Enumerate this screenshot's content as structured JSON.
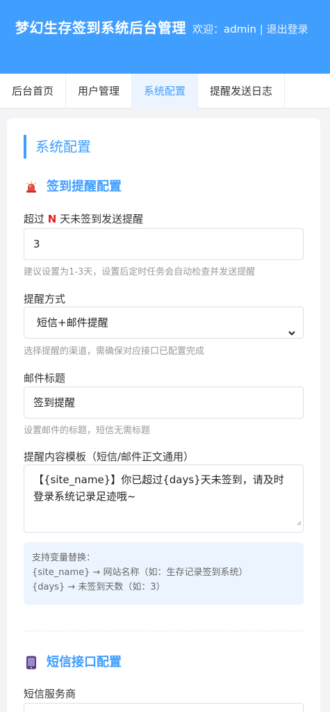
{
  "header": {
    "title": "梦幻生存签到系统后台管理",
    "welcome": "欢迎：",
    "username": "admin",
    "separator": " | ",
    "logout": "退出登录"
  },
  "nav": {
    "tabs": [
      {
        "label": "后台首页",
        "active": false
      },
      {
        "label": "用户管理",
        "active": false
      },
      {
        "label": "系统配置",
        "active": true
      },
      {
        "label": "提醒发送日志",
        "active": false
      }
    ]
  },
  "page": {
    "section_title": "系统配置",
    "reminder": {
      "title": "签到提醒配置",
      "icon": "siren-icon",
      "days_label_prefix": "超过",
      "days_label_n": "N",
      "days_label_suffix": "天未签到发送提醒",
      "days_value": "3",
      "days_hint": "建议设置为1-3天，设置后定时任务会自动检查并发送提醒",
      "method_label": "提醒方式",
      "method_value": "短信+邮件提醒",
      "method_hint": "选择提醒的渠道，需确保对应接口已配置完成",
      "subject_label": "邮件标题",
      "subject_value": "签到提醒",
      "subject_hint": "设置邮件的标题，短信无需标题",
      "template_label": "提醒内容模板（短信/邮件正文通用）",
      "template_value": "【{site_name}】你已超过{days}天未签到，请及时登录系统记录足迹哦~",
      "vars_title": "支持变量替换：",
      "var1": "{site_name} → 网站名称（如：生存记录签到系统）",
      "var2": "{days} → 未签到天数（如：3）"
    },
    "sms": {
      "title": "短信接口配置",
      "icon": "phone-icon",
      "provider_label": "短信服务商"
    }
  },
  "colors": {
    "primary": "#409eff",
    "danger": "#e02020"
  }
}
